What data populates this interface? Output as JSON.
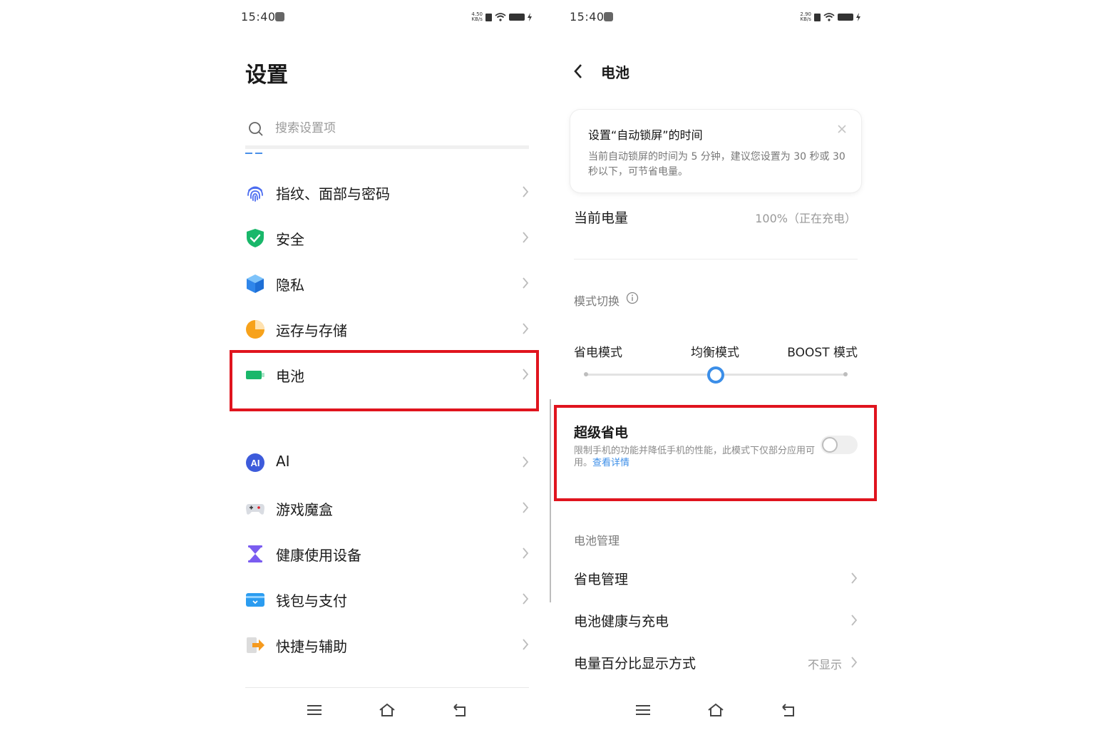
{
  "left": {
    "status": {
      "time": "15:40",
      "net_speed_value": "4.50",
      "net_speed_unit": "KB/s"
    },
    "title": "设置",
    "search": {
      "placeholder": "搜索设置项"
    },
    "menu": [
      {
        "label": "指纹、面部与密码",
        "icon": "fingerprint-icon"
      },
      {
        "label": "安全",
        "icon": "shield-icon"
      },
      {
        "label": "隐私",
        "icon": "privacy-cube-icon"
      },
      {
        "label": "运存与存储",
        "icon": "storage-pie-icon"
      },
      {
        "label": "电池",
        "icon": "battery-icon"
      },
      {
        "label": "AI",
        "icon": "ai-icon"
      },
      {
        "label": "游戏魔盒",
        "icon": "gamepad-icon"
      },
      {
        "label": "健康使用设备",
        "icon": "hourglass-icon"
      },
      {
        "label": "钱包与支付",
        "icon": "wallet-icon"
      },
      {
        "label": "快捷与辅助",
        "icon": "shortcut-icon"
      }
    ],
    "highlighted_item": "电池"
  },
  "right": {
    "status": {
      "time": "15:40",
      "net_speed_value": "2.90",
      "net_speed_unit": "KB/s"
    },
    "title": "电池",
    "tip": {
      "title": "设置“自动锁屏”的时间",
      "body": "当前自动锁屏的时间为 5 分钟，建议您设置为 30 秒或 30 秒以下，可节省电量。"
    },
    "current_level": {
      "label": "当前电量",
      "value": "100%（正在充电）"
    },
    "mode_switch": {
      "label": "模式切换",
      "modes": [
        "省电模式",
        "均衡模式",
        "BOOST 模式"
      ],
      "selected": "均衡模式"
    },
    "super_saver": {
      "title": "超级省电",
      "desc": "限制手机的功能并降低手机的性能，此模式下仅部分应用可用。",
      "link": "查看详情",
      "enabled": false
    },
    "management": {
      "label": "电池管理",
      "rows": [
        {
          "label": "省电管理",
          "value": ""
        },
        {
          "label": "电池健康与充电",
          "value": ""
        },
        {
          "label": "电量百分比显示方式",
          "value": "不显示"
        }
      ]
    }
  },
  "colors": {
    "highlight": "#e0141e",
    "accent": "#3b8ee8",
    "battery_green": "#19b76a"
  }
}
